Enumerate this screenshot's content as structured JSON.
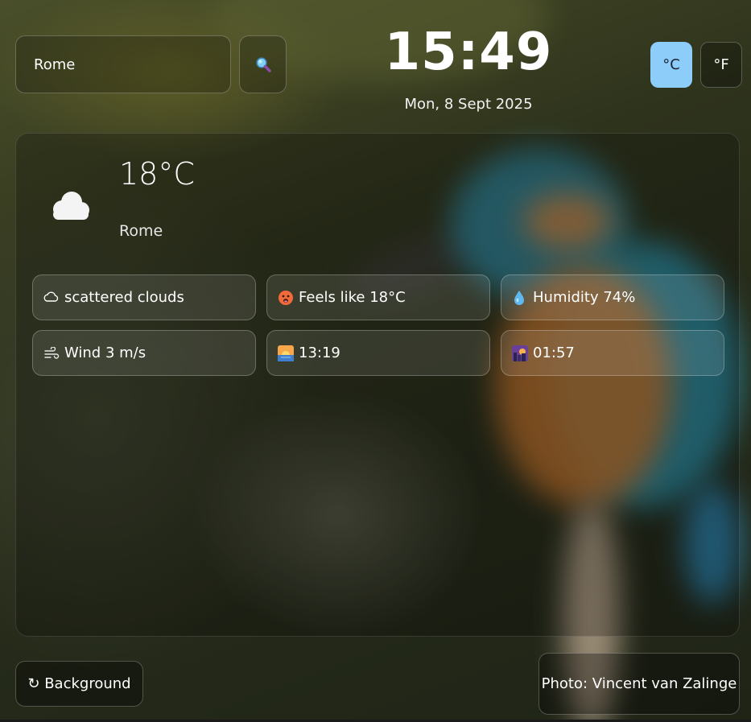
{
  "search": {
    "value": "Rome",
    "button_icon": "search-icon"
  },
  "clock": {
    "time": "15:49",
    "date": "Mon, 8 Sept 2025"
  },
  "units": {
    "celsius_label": "°C",
    "fahrenheit_label": "°F",
    "active": "celsius",
    "active_color": "#8dcdfa"
  },
  "current": {
    "icon": "cloud-icon",
    "temperature": "18°C",
    "city": "Rome"
  },
  "details": [
    {
      "icon": "cloud-outline-icon",
      "text": "scattered clouds"
    },
    {
      "icon": "hot-face-icon",
      "text": "Feels like 18°C"
    },
    {
      "icon": "droplet-icon",
      "text": "Humidity 74%"
    },
    {
      "icon": "wind-icon",
      "text": "Wind 3 m/s"
    },
    {
      "icon": "sunrise-icon",
      "text": "13:19"
    },
    {
      "icon": "sunset-icon",
      "text": "01:57"
    }
  ],
  "footer": {
    "background_button": "↻ Background",
    "photo_credit": "Photo: Vincent van Zalinge"
  }
}
